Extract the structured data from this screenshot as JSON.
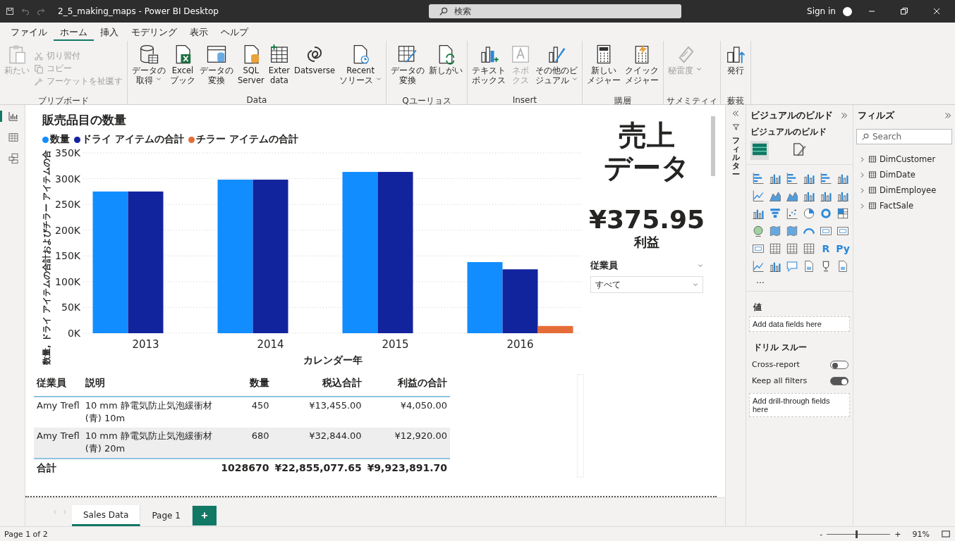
{
  "window": {
    "title": "2_5_making_maps - Power BI Desktop",
    "search_placeholder": "検索",
    "sign_in": "Sign in"
  },
  "menu": [
    {
      "label": "ファイル",
      "selected": false
    },
    {
      "label": "ホーム",
      "selected": true
    },
    {
      "label": "挿入",
      "selected": false
    },
    {
      "label": "モデリング",
      "selected": false
    },
    {
      "label": "表示",
      "selected": false
    },
    {
      "label": "ヘルプ",
      "selected": false
    }
  ],
  "ribbon": [
    {
      "label": "ブリブボード",
      "items": [
        {
          "kind": "large",
          "lines": [
            "莉たい"
          ],
          "disabled": true
        },
        {
          "kind": "stack",
          "items": [
            {
              "label": "切り習付",
              "disabled": true
            },
            {
              "label": "コピー",
              "disabled": true
            },
            {
              "label": "フーケットを祉匽す",
              "disabled": true
            }
          ]
        }
      ]
    },
    {
      "label": "Data",
      "items": [
        {
          "kind": "large",
          "lines": [
            "データの",
            "取得"
          ],
          "disabled": false,
          "dropdown": true
        },
        {
          "kind": "large",
          "lines": [
            "Excel",
            "ブック"
          ],
          "disabled": false
        },
        {
          "kind": "large",
          "lines": [
            "データの",
            "変換"
          ],
          "disabled": false
        },
        {
          "kind": "large",
          "lines": [
            "SQL",
            "Server"
          ],
          "disabled": false
        },
        {
          "kind": "large",
          "lines": [
            "Exter",
            "data"
          ],
          "disabled": false
        },
        {
          "kind": "large",
          "lines": [
            "Datsverse"
          ],
          "disabled": false
        },
        {
          "kind": "large",
          "lines": [
            "Recent",
            "ソリース"
          ],
          "disabled": false,
          "dropdown": true
        }
      ]
    },
    {
      "label": "Qユーリョス",
      "items": [
        {
          "kind": "large",
          "lines": [
            "データの",
            "変換"
          ],
          "disabled": false
        },
        {
          "kind": "large",
          "lines": [
            "新しがい"
          ],
          "disabled": false
        }
      ]
    },
    {
      "label": "Insert",
      "items": [
        {
          "kind": "large",
          "lines": [
            "テキスト",
            "ボックス"
          ],
          "disabled": false
        },
        {
          "kind": "large",
          "lines": [
            "ネボ",
            "クス"
          ],
          "disabled": true
        },
        {
          "kind": "large",
          "lines": [
            "その他のビ",
            "ジュアル"
          ],
          "disabled": false,
          "dropdown": true
        }
      ]
    },
    {
      "label": "購層",
      "items": [
        {
          "kind": "large",
          "lines": [
            "新しい",
            "メジャー"
          ],
          "disabled": false
        },
        {
          "kind": "large",
          "lines": [
            "クイック",
            "メジャー"
          ],
          "disabled": false
        }
      ]
    },
    {
      "label": "サメミティィ",
      "items": [
        {
          "kind": "large",
          "lines": [
            "秘雷度"
          ],
          "disabled": true,
          "dropdown": true
        }
      ]
    },
    {
      "label": "薮莪",
      "items": [
        {
          "kind": "large",
          "lines": [
            "発行"
          ],
          "disabled": false
        }
      ]
    }
  ],
  "left_rail": [
    {
      "selected": true
    },
    {
      "selected": false
    },
    {
      "selected": false
    }
  ],
  "chart": {
    "chart_data": {
      "type": "bar",
      "title": "販売品目の数量",
      "xlabel": "カレンダー年",
      "ylabel": "数量, ドライ アイテムの合計およびチラー アイテムの合",
      "legend": "top",
      "grid": true,
      "categories": [
        "2013",
        "2014",
        "2015",
        "2016"
      ],
      "series": [
        {
          "name": "数量",
          "color": "#118dff",
          "values": [
            275000,
            298000,
            313000,
            138000
          ]
        },
        {
          "name": "ドライ アイテムの合計",
          "color": "#12239e",
          "values": [
            275000,
            298000,
            313000,
            124000
          ]
        },
        {
          "name": "チラー アイテムの合計",
          "color": "#e66c37",
          "values": [
            null,
            null,
            null,
            14000
          ]
        }
      ],
      "ylim": [
        0,
        350000
      ],
      "yticks": [
        {
          "value": 0,
          "label": "0K"
        },
        {
          "value": 50000,
          "label": "50K"
        },
        {
          "value": 100000,
          "label": "100K"
        },
        {
          "value": 150000,
          "label": "150K"
        },
        {
          "value": 200000,
          "label": "200K"
        },
        {
          "value": 250000,
          "label": "250K"
        },
        {
          "value": 300000,
          "label": "300K"
        },
        {
          "value": 350000,
          "label": "350K"
        }
      ]
    }
  },
  "text_box": [
    "売上",
    "データ"
  ],
  "card": {
    "value": "¥375.95",
    "label": "利益"
  },
  "slicer": {
    "title": "従業員",
    "value": "すべて"
  },
  "table": {
    "columns": [
      "従業員",
      "説明",
      "数量",
      "税込合計",
      "利益の合計"
    ],
    "rows": [
      [
        "Amy Trefl",
        "10 mm 静電気防止気泡緩衝材 (青) 10m",
        "450",
        "¥13,455.00",
        "¥4,050.00"
      ],
      [
        "Amy Trefl",
        "10 mm 静電気防止気泡緩衝材 (青) 20m",
        "680",
        "¥32,844.00",
        "¥12,920.00"
      ]
    ],
    "total": {
      "label": "合計",
      "values": [
        "1028670",
        "¥22,855,077.65",
        "¥9,923,891.70"
      ]
    }
  },
  "page_tabs": [
    {
      "label": "Sales Data",
      "selected": true
    },
    {
      "label": "Page 1",
      "selected": false
    }
  ],
  "add_page": "+",
  "filters_pane": {
    "label": "フィルター"
  },
  "visualizations": {
    "title": "ビジュアルのビルド",
    "subtitle": "ビジュアルのビルド",
    "tabs": [
      {
        "selected": true
      },
      {
        "selected": false
      }
    ],
    "icons": [
      {
        "kind": "bar"
      },
      {
        "kind": "column"
      },
      {
        "kind": "bar"
      },
      {
        "kind": "column"
      },
      {
        "kind": "bar"
      },
      {
        "kind": "column"
      },
      {
        "kind": "line"
      },
      {
        "kind": "area"
      },
      {
        "kind": "area"
      },
      {
        "kind": "column"
      },
      {
        "kind": "column"
      },
      {
        "kind": "column"
      },
      {
        "kind": "column"
      },
      {
        "kind": "funnel"
      },
      {
        "kind": "scatter"
      },
      {
        "kind": "pie"
      },
      {
        "kind": "donut"
      },
      {
        "kind": "treemap"
      },
      {
        "kind": "globe"
      },
      {
        "kind": "map"
      },
      {
        "kind": "map"
      },
      {
        "kind": "gauge"
      },
      {
        "kind": "card"
      },
      {
        "kind": "card"
      },
      {
        "kind": "card"
      },
      {
        "kind": "table"
      },
      {
        "kind": "table"
      },
      {
        "kind": "table"
      },
      {
        "kind": "text",
        "text": "R"
      },
      {
        "kind": "text",
        "text": "Py"
      },
      {
        "kind": "line"
      },
      {
        "kind": "column"
      },
      {
        "kind": "speech"
      },
      {
        "kind": "document"
      },
      {
        "kind": "trophy"
      },
      {
        "kind": "document"
      }
    ],
    "more": "…",
    "values_label": "値",
    "values_well": "Add data fields here",
    "drill_label": "ドリル スルー",
    "toggles": [
      {
        "label": "Cross-report",
        "on": false
      },
      {
        "label": "Keep all filters",
        "on": true
      }
    ],
    "drill_well": "Add drill-through fields here"
  },
  "data_pane": {
    "title": "フィルズ",
    "search_placeholder": "Search",
    "tables": [
      {
        "name": "DimCustomer",
        "expanded": false
      },
      {
        "name": "DimDate",
        "expanded": false
      },
      {
        "name": "DimEmployee",
        "expanded": false
      },
      {
        "name": "FactSale",
        "expanded": false
      }
    ]
  },
  "status_bar": {
    "page": "Page 1 of 2",
    "zoom": "91%",
    "zoom_slider": {
      "level": 0.45
    },
    "minus": "-",
    "plus": "+"
  }
}
